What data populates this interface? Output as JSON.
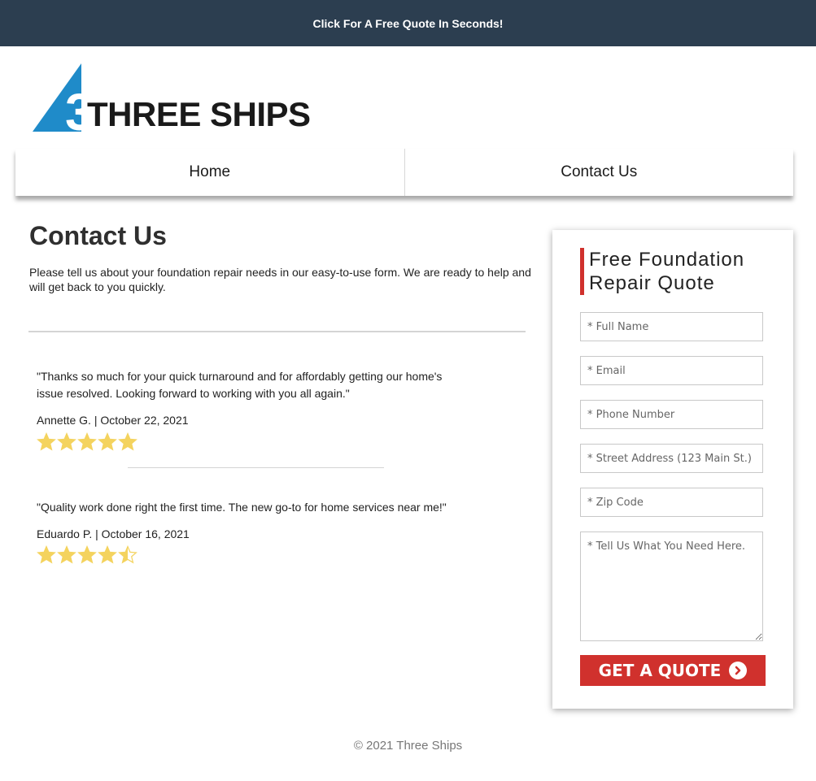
{
  "topbar": {
    "cta_label": "Click For A Free Quote In Seconds!"
  },
  "logo": {
    "text": "THREE SHIPS",
    "accent_color": "#1f8bc9"
  },
  "nav": {
    "items": [
      {
        "label": "Home"
      },
      {
        "label": "Contact Us"
      }
    ]
  },
  "main": {
    "title": "Contact Us",
    "intro": "Please tell us about your foundation repair needs in our easy-to-use form. We are ready to help and will get back to you quickly."
  },
  "reviews": [
    {
      "quote": "\"Thanks so much for your quick turnaround and for affordably getting our home's issue resolved. Looking forward to working with you all again.\"",
      "author": "Annette G. | October 22, 2021",
      "rating": 5
    },
    {
      "quote": "\"Quality work done right the first time. The new go-to for home services near me!\"",
      "author": "Eduardo P. | October 16, 2021",
      "rating": 4.5
    }
  ],
  "form": {
    "heading": "Free Foundation Repair Quote",
    "fields": [
      {
        "placeholder": "* Full Name",
        "value": ""
      },
      {
        "placeholder": "* Email",
        "value": ""
      },
      {
        "placeholder": "* Phone Number",
        "value": ""
      },
      {
        "placeholder": "* Street Address (123 Main St.)",
        "value": ""
      },
      {
        "placeholder": "* Zip Code",
        "value": ""
      }
    ],
    "message_placeholder": "* Tell Us What You Need Here.",
    "submit_label": "GET A QUOTE",
    "submit_icon": "chevron-right-circle-icon"
  },
  "footer": {
    "copyright": "© 2021 Three Ships"
  },
  "colors": {
    "topbar": "#2c3e50",
    "accent_red": "#d0312d",
    "star": "#f4d35e",
    "star_empty_stroke": "#f4d35e"
  }
}
